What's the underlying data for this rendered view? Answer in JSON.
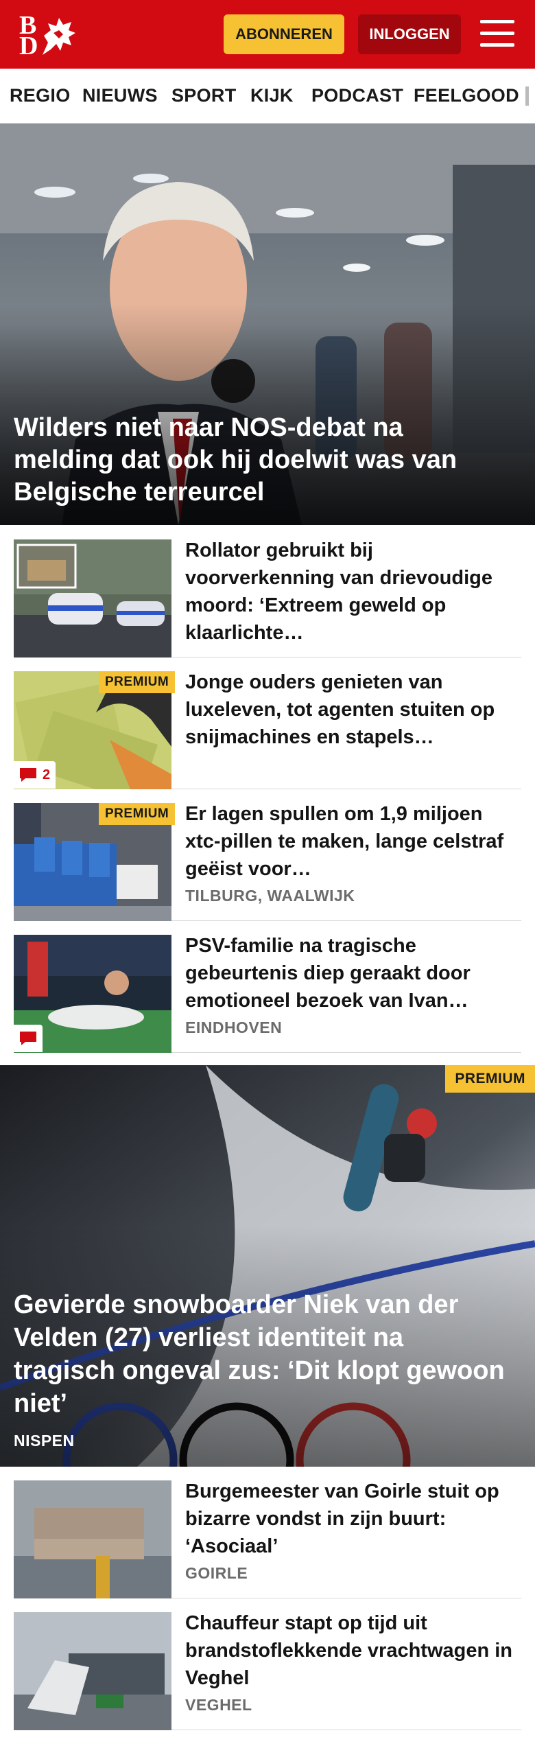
{
  "header": {
    "logo_text": "BD",
    "subscribe_label": "ABONNEREN",
    "login_label": "INLOGGEN",
    "menu_icon": "hamburger-menu-icon",
    "brand_color": "#d20a11",
    "subscribe_color": "#f6c233"
  },
  "nav": {
    "items": [
      "REGIO",
      "NIEUWS",
      "SPORT",
      "KIJK",
      "PODCAST",
      "FEELGOOD"
    ]
  },
  "hero": {
    "title": "Wilders niet naar NOS-debat na melding dat ook hij doelwit was van Belgische terreurcel"
  },
  "articles": [
    {
      "title": "Rollator gebruikt bij voorverkenning van drievoudige moord: ‘Extreem geweld op klaarlichte…",
      "premium": false,
      "comments": "",
      "location": ""
    },
    {
      "title": "Jonge ouders genieten van luxeleven, tot agenten stuiten op snijmachines en stapels…",
      "premium": true,
      "premium_label": "PREMIUM",
      "comments": "2",
      "location": ""
    },
    {
      "title": "Er lagen spullen om 1,9 miljoen xtc-pillen te maken, lange celstraf geëist voor…",
      "premium": true,
      "premium_label": "PREMIUM",
      "comments": "",
      "location": "TILBURG, WAALWIJK"
    },
    {
      "title": "PSV-familie na tragische gebeurtenis diep geraakt door emotioneel bezoek van Ivan…",
      "premium": false,
      "comments": "",
      "location": "EINDHOVEN"
    }
  ],
  "feature": {
    "premium_label": "PREMIUM",
    "title": "Gevierde snowboarder Niek van der Velden (27) verliest identiteit na tragisch ongeval zus: ‘Dit klopt gewoon niet’",
    "location": "NISPEN"
  },
  "articles2": [
    {
      "title": "Burgemeester van Goirle stuit op bizarre vondst in zijn buurt: ‘Asociaal’",
      "location": "GOIRLE"
    },
    {
      "title": "Chauffeur stapt op tijd uit brandstoflekkende vrachtwagen in Veghel",
      "location": "VEGHEL"
    }
  ]
}
